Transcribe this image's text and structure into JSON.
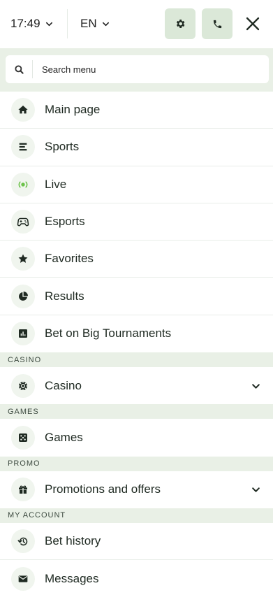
{
  "header": {
    "time": "17:49",
    "language": "EN"
  },
  "search": {
    "placeholder": "Search menu"
  },
  "menu": {
    "main_page": "Main page",
    "sports": "Sports",
    "live": "Live",
    "esports": "Esports",
    "favorites": "Favorites",
    "results": "Results",
    "big_tournaments": "Bet on Big Tournaments",
    "casino_section": "CASINO",
    "casino": "Casino",
    "games_section": "GAMES",
    "games": "Games",
    "promo_section": "PROMO",
    "promotions": "Promotions and offers",
    "account_section": "MY ACCOUNT",
    "bet_history": "Bet history",
    "messages": "Messages"
  },
  "colors": {
    "accent_green": "#6cc24a",
    "section_bg": "#e9f0e6",
    "button_bg": "#dbe8d8"
  }
}
